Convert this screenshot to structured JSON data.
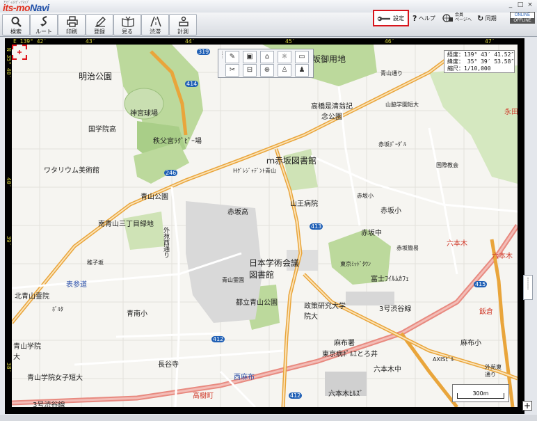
{
  "app": {
    "logo_tiny": "ｱﾗﾃﾞｨｽﾏﾃﾞｨｱﾏｯﾌﾟ",
    "logo_main": "its-mo",
    "logo_navi": "Navi"
  },
  "window_controls": [
    "_",
    "□",
    "×"
  ],
  "toolbar": {
    "buttons": [
      {
        "label": "検索",
        "icon": "search-icon"
      },
      {
        "label": "ルート",
        "icon": "route-icon"
      },
      {
        "label": "印刷",
        "icon": "printer-icon"
      },
      {
        "label": "登録",
        "icon": "register-pencil-icon"
      },
      {
        "label": "見る",
        "icon": "view-book-icon"
      },
      {
        "label": "渋滞",
        "icon": "traffic-road-icon"
      },
      {
        "label": "計測",
        "icon": "measure-icon"
      }
    ],
    "settings_label": "設定",
    "help_label": "ヘルプ",
    "member_label_1": "会員",
    "member_label_2": "ページへ",
    "sync_label": "同期",
    "online_label": "ONLINE",
    "offline_label": "OFFLINE"
  },
  "coords": {
    "top_left": "E 139° 42′",
    "top_ticks": [
      "43′",
      "44′",
      "45′",
      "46′",
      "47′"
    ],
    "left_top": "N 35° 40′",
    "left_ticks": [
      "40′",
      "39′",
      "38′"
    ]
  },
  "info_box": {
    "lon": "経度：139° 43′ 41.52″",
    "lat": "緯度： 35° 39′ 53.58″",
    "scale": "縮尺：1/10,000"
  },
  "scale_bar": {
    "label": "300m"
  },
  "map_labels": [
    {
      "t": "明治公園",
      "c": "big"
    },
    {
      "t": "神宮球場",
      "c": ""
    },
    {
      "t": "国学院高",
      "c": ""
    },
    {
      "t": "秩父宮ﾗｸﾞﾋﾞｰ場",
      "c": ""
    },
    {
      "t": "ワタリウム美術館",
      "c": ""
    },
    {
      "t": "青山公園",
      "c": ""
    },
    {
      "t": "南青山三丁目緑地",
      "c": ""
    },
    {
      "t": "赤坂高",
      "c": ""
    },
    {
      "t": "ｍ赤坂図書館",
      "c": "big"
    },
    {
      "t": "Hｸﾞﾚｼﾞｬﾃﾞﾝﾄ青山",
      "c": "small"
    },
    {
      "t": "山王病院",
      "c": ""
    },
    {
      "t": "高橋是清翁記念公園",
      "c": ""
    },
    {
      "t": "赤坂御用地",
      "c": "big"
    },
    {
      "t": "青山通り",
      "c": "small"
    },
    {
      "t": "山脇学園短大",
      "c": "small"
    },
    {
      "t": "赤坂ﾎﾟｰﾀﾞﾙ",
      "c": "small"
    },
    {
      "t": "国際教会",
      "c": "small"
    },
    {
      "t": "赤坂小",
      "c": "small"
    },
    {
      "t": "赤坂中",
      "c": ""
    },
    {
      "t": "六本木",
      "c": "red"
    },
    {
      "t": "日本学術会議図書館",
      "c": "big"
    },
    {
      "t": "外苑西通り",
      "c": "vert"
    },
    {
      "t": "都立青山公園",
      "c": ""
    },
    {
      "t": "政策研究大学院大",
      "c": ""
    },
    {
      "t": "東京ﾐｯﾄﾞﾀｳﾝ",
      "c": "small"
    },
    {
      "t": "富士ﾌｲﾙﾑｶﾌｪ",
      "c": ""
    },
    {
      "t": "3号渋谷線",
      "c": ""
    },
    {
      "t": "北青山霊院",
      "c": ""
    },
    {
      "t": "青南小",
      "c": ""
    },
    {
      "t": "麻布署",
      "c": ""
    },
    {
      "t": "東京病ﾎﾟﾙｴとろ井",
      "c": ""
    },
    {
      "t": "六本木ﾋﾙｽﾞ",
      "c": ""
    },
    {
      "t": "青山学院女子短大",
      "c": ""
    },
    {
      "t": "長谷寺",
      "c": ""
    },
    {
      "t": "西麻布",
      "c": "blue"
    },
    {
      "t": "高樹町",
      "c": "red"
    },
    {
      "t": "3号渋谷線",
      "c": ""
    },
    {
      "t": "六本木中",
      "c": ""
    },
    {
      "t": "麻布小",
      "c": ""
    },
    {
      "t": "AXISﾋﾞﾙ",
      "c": "small"
    },
    {
      "t": "外苑東通り",
      "c": "small"
    },
    {
      "t": "飯倉",
      "c": "red"
    },
    {
      "t": "永田",
      "c": "red"
    },
    {
      "t": "青山霊園",
      "c": "small"
    },
    {
      "t": "表参道",
      "c": "blue"
    },
    {
      "t": "青山学院大",
      "c": ""
    },
    {
      "t": "六本木",
      "c": "red"
    },
    {
      "t": "赤坂簡易",
      "c": "small"
    },
    {
      "t": "稚子坂",
      "c": "small"
    },
    {
      "t": "ﾎﾞﾙﾀ",
      "c": "small"
    },
    {
      "t": "赤坂小",
      "c": ""
    }
  ],
  "route_numbers": [
    "319",
    "414",
    "246",
    "413",
    "415",
    "412",
    "412"
  ],
  "colors": {
    "road_orange": "#e8a13a",
    "expressway_red": "#e8827a",
    "park_green": "#b8d89a",
    "building_gray": "#d7d7d7",
    "highlight_red": "#d8141b"
  }
}
